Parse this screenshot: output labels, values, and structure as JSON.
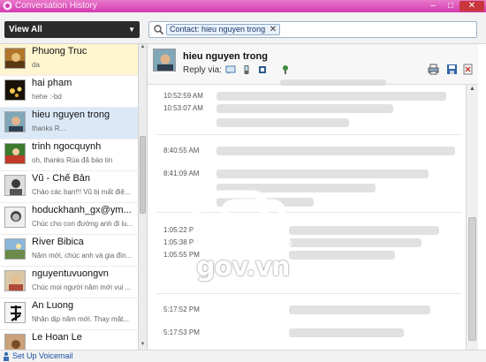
{
  "window": {
    "title": "Conversation History",
    "minimize": "–",
    "maximize": "□",
    "close": "✕"
  },
  "toolbar": {
    "view_filter": "View All",
    "search_chip": "Contact: hieu nguyen trong",
    "chip_remove": "✕"
  },
  "contacts": [
    {
      "name": "Phuong Truc",
      "status": "da"
    },
    {
      "name": "hai pham",
      "status": "hehe :-bd"
    },
    {
      "name": "hieu nguyen trong",
      "status": "thanks R..."
    },
    {
      "name": "trinh ngocquynh",
      "status": "oh, thanks Rùa đã báo tin"
    },
    {
      "name": "Vũ - Chế Bản",
      "status": "Chào các bạn!!! Vũ bị mất điệ..."
    },
    {
      "name": "hoduckhanh_gx@ym...",
      "status": "Chúc cho con đường anh đi lu..."
    },
    {
      "name": "River Bibica",
      "status": "Năm mới, chúc anh và gia đìn..."
    },
    {
      "name": "nguyentuvuongvn",
      "status": "Chúc mọi người năm mới vui ..."
    },
    {
      "name": "An Luong",
      "status": "Nhân dịp năm mới. Thay mặt..."
    },
    {
      "name": "Le Hoan Le",
      "status": ""
    }
  ],
  "conversation": {
    "contact_name": "hieu nguyen trong",
    "reply_via": "Reply via:",
    "timestamps": [
      "10:52:59 AM",
      "10:53:07 AM",
      "8:40:55 AM",
      "8:41:09 AM",
      "1:05:22 PM",
      "1:05:38 PM",
      "1:05:55 PM",
      "5:17:52 PM",
      "5:17:53 PM"
    ]
  },
  "watermark": "gov.vn",
  "statusbar": {
    "link": "Set Up Voicemail"
  },
  "colors": {
    "titlebar": "#d33ab0",
    "selected_contact": "#fff6cf",
    "active_contact": "#dbe9f7",
    "link": "#1a4ea3"
  }
}
